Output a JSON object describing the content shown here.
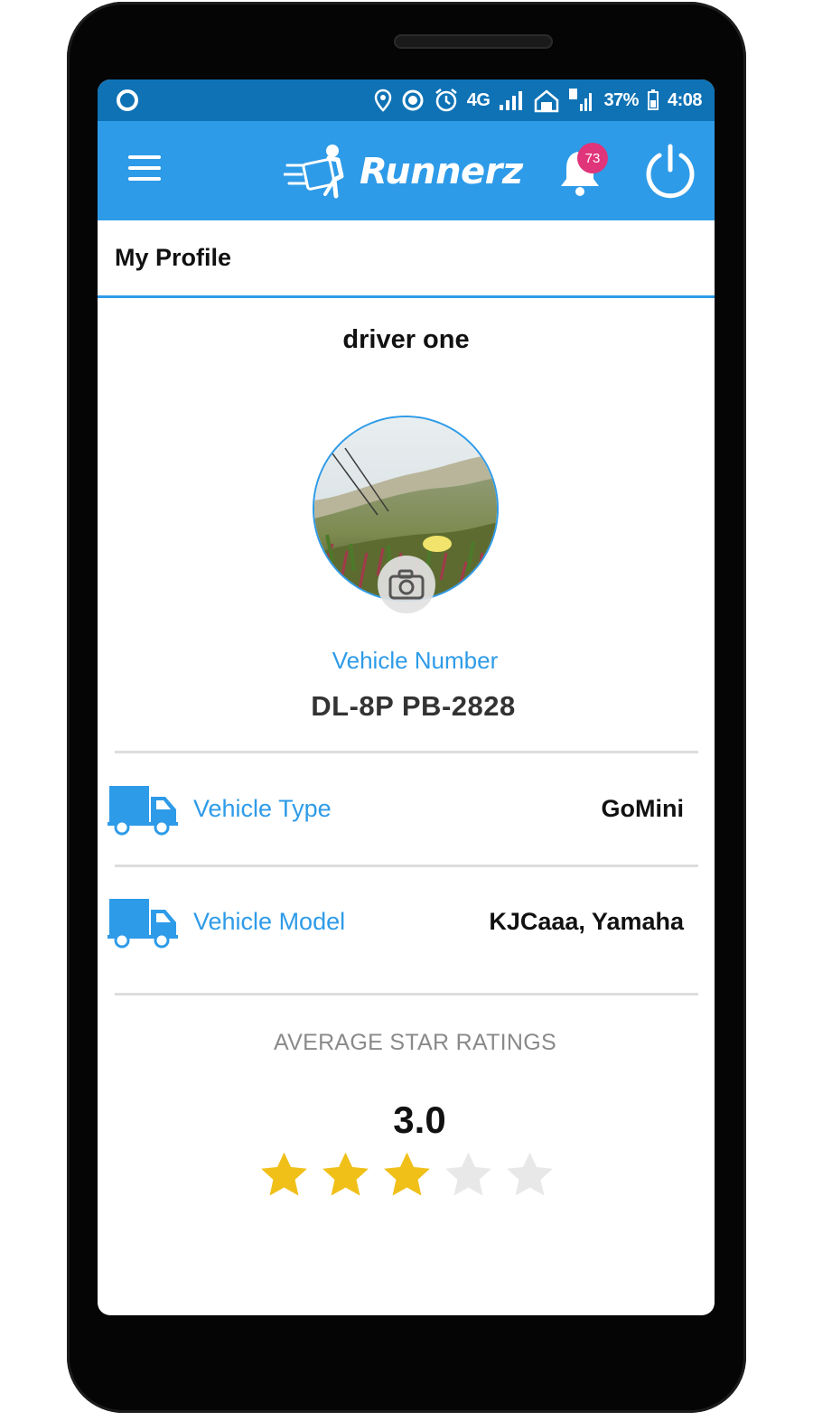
{
  "status_bar": {
    "battery": "37%",
    "time": "4:08",
    "network": "4G"
  },
  "app_bar": {
    "brand": "Runnerz",
    "notification_count": "73"
  },
  "page": {
    "title": "My Profile"
  },
  "profile": {
    "name": "driver one",
    "vehicle_number_label": "Vehicle Number",
    "vehicle_number": "DL-8P PB-2828",
    "details": [
      {
        "label": "Vehicle Type",
        "value": "GoMini",
        "icon": "truck-icon"
      },
      {
        "label": "Vehicle Model",
        "value": "KJCaaa, Yamaha",
        "icon": "truck-icon"
      }
    ]
  },
  "ratings": {
    "title": "AVERAGE STAR RATINGS",
    "value": "3.0",
    "stars_filled": 3,
    "stars_total": 5
  },
  "colors": {
    "primary": "#2e9be8",
    "status_bar": "#0e72b5",
    "badge": "#e0357a",
    "star_filled": "#f0c019",
    "star_empty": "#e8e8e8"
  }
}
